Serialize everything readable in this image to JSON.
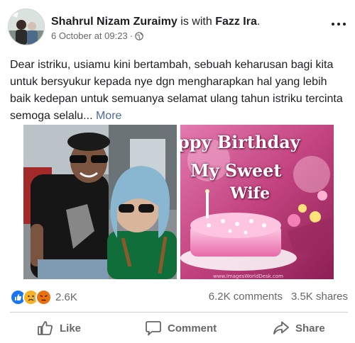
{
  "post": {
    "author": "Shahrul Nizam Zuraimy",
    "with_text": "is with",
    "tagged": "Fazz Ira",
    "tagged_suffix": ".",
    "timestamp": "6 October at 09:23",
    "separator": "·",
    "privacy_icon": "globe-icon",
    "text": "Dear istriku, usiamu kini bertambah, sebuah keharusan bagi kita untuk bersyukur kepada nye dgn mengharapkan hal yang lebih baik kedepan untuk semuanya selamat ulang tahun istriku tercinta semoga selalu...",
    "more_label": "More"
  },
  "photo2": {
    "line1": "ppy Birthday",
    "line2": "My Sweet",
    "line3": "Wife",
    "watermark": "www.ImagesWorldDesk.com"
  },
  "stats": {
    "reaction_icons": [
      "like-icon",
      "sad-icon",
      "angry-icon"
    ],
    "reactions_count": "2.6K",
    "comments": "6.2K comments",
    "shares": "3.5K shares"
  },
  "actions": {
    "like": "Like",
    "comment": "Comment",
    "share": "Share"
  },
  "colors": {
    "like_blue": "#1877f2",
    "sad_yellow": "#f7b125",
    "angry_orange": "#e9710f",
    "text": "#1c1e21",
    "muted": "#65676b",
    "more_link": "#4b6a9b"
  }
}
